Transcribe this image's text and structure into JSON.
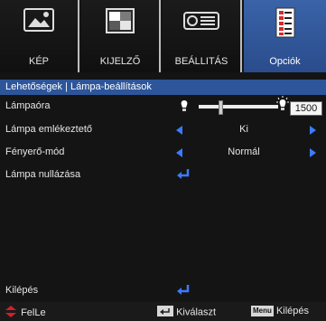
{
  "tabs": [
    {
      "label": "KÉP",
      "icon": "image-icon"
    },
    {
      "label": "KIJELZŐ",
      "icon": "display-icon"
    },
    {
      "label": "BEÁLLITÁS",
      "icon": "projector-icon"
    },
    {
      "label": "Opciók",
      "icon": "options-icon"
    }
  ],
  "breadcrumb": "Lehetőségek | Lámpa-beállítások",
  "rows": {
    "lamp_hours": {
      "label": "Lámpaóra",
      "value": "1500"
    },
    "lamp_reminder": {
      "label": "Lámpa emlékeztető",
      "value": "Ki"
    },
    "brightness_mode": {
      "label": "Fényerő-mód",
      "value": "Normál"
    },
    "lamp_reset": {
      "label": "Lámpa nullázása"
    },
    "exit": {
      "label": "Kilépés"
    }
  },
  "footer": {
    "updown": "FelLe",
    "select": "Kiválaszt",
    "menu_key": "Menu",
    "exit": "Kilépés"
  },
  "colors": {
    "accent": "#2d559a",
    "arrow": "#3a7bff",
    "nav": "#d0202a",
    "background": "#141414"
  }
}
